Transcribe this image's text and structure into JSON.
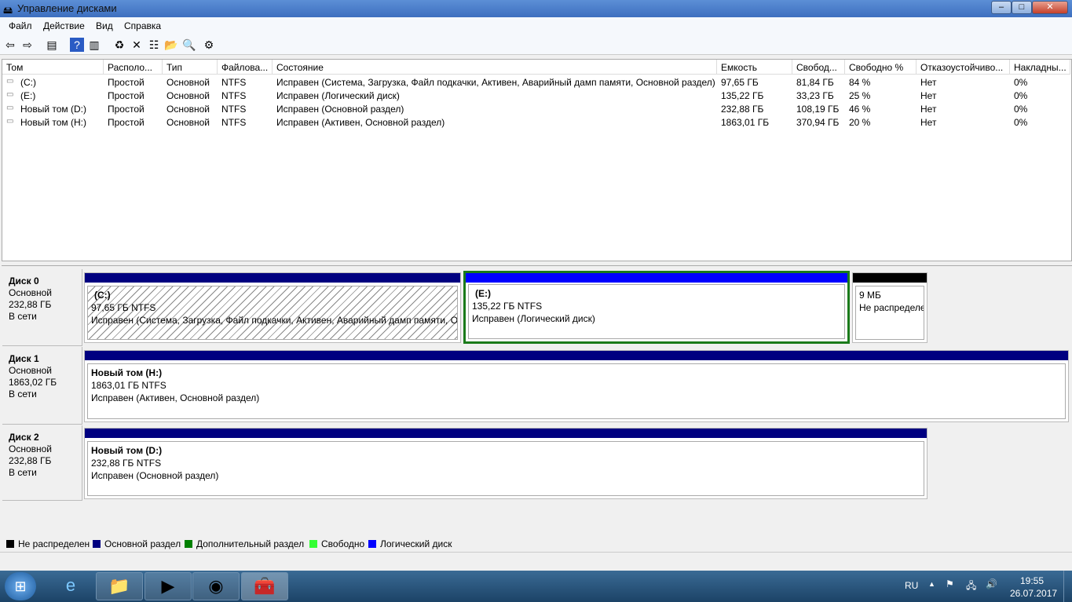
{
  "window": {
    "title": "Управление дисками",
    "min": "‒",
    "max": "□",
    "close": "✕"
  },
  "menu": [
    "Файл",
    "Действие",
    "Вид",
    "Справка"
  ],
  "toolbar": [
    {
      "icon": "back-icon",
      "g": "⇦"
    },
    {
      "icon": "forward-icon",
      "g": "⇨"
    },
    {
      "icon": "console-tree-icon",
      "g": "▤"
    },
    {
      "icon": "help-icon",
      "g": "?"
    },
    {
      "icon": "action-pane-icon",
      "g": "▥"
    },
    {
      "icon": "refresh-icon",
      "g": "♻"
    },
    {
      "icon": "delete-icon",
      "g": "✕"
    },
    {
      "icon": "properties-icon",
      "g": "☷"
    },
    {
      "icon": "open-icon",
      "g": "📂"
    },
    {
      "icon": "search-icon",
      "g": "🔍"
    },
    {
      "icon": "settings-icon",
      "g": "⚙"
    }
  ],
  "list": {
    "columns": [
      "Том",
      "Располо...",
      "Тип",
      "Файлова...",
      "Состояние",
      "Емкость",
      "Свобод...",
      "Свободно %",
      "Отказоустойчиво...",
      "Накладны..."
    ],
    "rows": [
      [
        "(C:)",
        "Простой",
        "Основной",
        "NTFS",
        "Исправен (Система, Загрузка, Файл подкачки, Активен, Аварийный дамп памяти, Основной раздел)",
        "97,65 ГБ",
        "81,84 ГБ",
        "84 %",
        "Нет",
        "0%"
      ],
      [
        "(E:)",
        "Простой",
        "Основной",
        "NTFS",
        "Исправен (Логический диск)",
        "135,22 ГБ",
        "33,23 ГБ",
        "25 %",
        "Нет",
        "0%"
      ],
      [
        "Новый том (D:)",
        "Простой",
        "Основной",
        "NTFS",
        "Исправен (Основной раздел)",
        "232,88 ГБ",
        "108,19 ГБ",
        "46 %",
        "Нет",
        "0%"
      ],
      [
        "Новый том (H:)",
        "Простой",
        "Основной",
        "NTFS",
        "Исправен (Активен, Основной раздел)",
        "1863,01 ГБ",
        "370,94 ГБ",
        "20 %",
        "Нет",
        "0%"
      ]
    ]
  },
  "disks": [
    {
      "name": "Диск 0",
      "type": "Основной",
      "size": "232,88 ГБ",
      "status": "В сети"
    },
    {
      "name": "Диск 1",
      "type": "Основной",
      "size": "1863,02 ГБ",
      "status": "В сети"
    },
    {
      "name": "Диск 2",
      "type": "Основной",
      "size": "232,88 ГБ",
      "status": "В сети"
    }
  ],
  "partitions": [
    {
      "name": "(C:)",
      "size": "97,65 ГБ NTFS",
      "status": "Исправен (Система, Загрузка, Файл подкачки, Активен, Аварийный дамп памяти, Основной раздел)"
    },
    {
      "name": "(E:)",
      "size": "135,22 ГБ NTFS",
      "status": "Исправен (Логический диск)"
    },
    {
      "name": "",
      "size": "9 МБ",
      "status": "Не распределен"
    },
    {
      "name": "Новый том  (H:)",
      "size": "1863,01 ГБ NTFS",
      "status": "Исправен (Активен, Основной раздел)"
    },
    {
      "name": "Новый том  (D:)",
      "size": "232,88 ГБ NTFS",
      "status": "Исправен (Основной раздел)"
    }
  ],
  "legend": [
    {
      "label": "Не распределен",
      "color": "#000000"
    },
    {
      "label": "Основной раздел",
      "color": "#000080"
    },
    {
      "label": "Дополнительный раздел",
      "color": "#008000"
    },
    {
      "label": "Свободно",
      "color": "#33ff33"
    },
    {
      "label": "Логический диск",
      "color": "#0000ff"
    }
  ],
  "taskbar": {
    "lang": "RU",
    "time": "19:55",
    "date": "26.07.2017"
  }
}
